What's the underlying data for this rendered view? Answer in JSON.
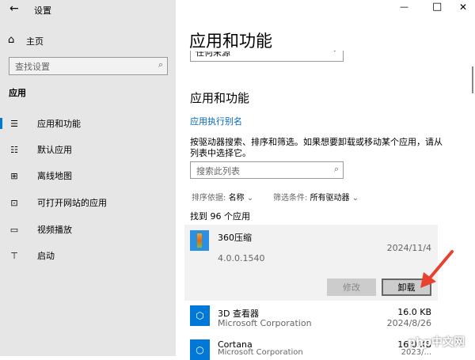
{
  "window": {
    "title": "设置",
    "minimize": "—",
    "maximize": "□",
    "close": "✕"
  },
  "sidebar": {
    "home": "主页",
    "search_placeholder": "查找设置",
    "section": "应用",
    "items": [
      {
        "label": "应用和功能",
        "icon": "list-icon",
        "glyph": "☰",
        "active": true
      },
      {
        "label": "默认应用",
        "icon": "default-apps-icon",
        "glyph": "☷"
      },
      {
        "label": "离线地图",
        "icon": "map-icon",
        "glyph": "⊞"
      },
      {
        "label": "可打开网站的应用",
        "icon": "open-web-icon",
        "glyph": "⊡"
      },
      {
        "label": "视频播放",
        "icon": "video-icon",
        "glyph": "▭"
      },
      {
        "label": "启动",
        "icon": "startup-icon",
        "glyph": "⊤"
      }
    ]
  },
  "main": {
    "title": "应用和功能",
    "source_dropdown": "任何来源",
    "subheading": "应用和功能",
    "alias_link": "应用执行别名",
    "description": "按驱动器搜索、排序和筛选。如果想要卸载或移动某个应用，请从列表中选择它。",
    "search_placeholder": "搜索此列表",
    "sort_label": "排序依据:",
    "sort_value": "名称",
    "filter_label": "筛选条件:",
    "filter_value": "所有驱动器",
    "found": "找到 96 个应用",
    "apps": [
      {
        "name": "360压缩",
        "date": "2024/11/4",
        "version": "4.0.0.1540",
        "modify": "修改",
        "uninstall": "卸载"
      },
      {
        "name": "3D 查看器",
        "publisher": "Microsoft Corporation",
        "size": "16.0 KB",
        "date": "2024/8/26"
      },
      {
        "name": "Cortana",
        "publisher": "Microsoft Corporation",
        "size": "16.0 KB",
        "date": "2023/..."
      }
    ]
  },
  "watermark": "php中文网",
  "colors": {
    "accent": "#0078d7",
    "sidebar": "#e6e6e6",
    "arrow": "#e8412f"
  }
}
